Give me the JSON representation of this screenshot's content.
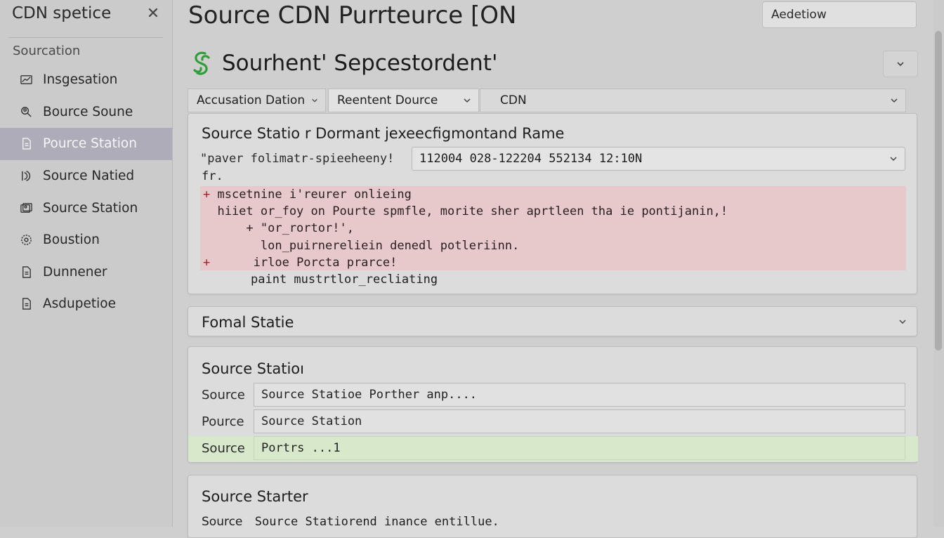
{
  "sidebar": {
    "title": "CDN spetice",
    "close_icon": "close-icon",
    "section": "Sourcation",
    "items": [
      {
        "label": "Insgesation",
        "icon": "chart-icon"
      },
      {
        "label": "Bource Soune",
        "icon": "search-user-icon"
      },
      {
        "label": "Pource Station",
        "icon": "document-icon",
        "active": true
      },
      {
        "label": "Source Natied",
        "icon": "sound-wave-icon"
      },
      {
        "label": "Source Station",
        "icon": "image-stack-icon"
      },
      {
        "label": "Boustion",
        "icon": "gear-icon"
      },
      {
        "label": "Dunnener",
        "icon": "document-icon"
      },
      {
        "label": "Asdupetioe",
        "icon": "document-icon"
      }
    ]
  },
  "header": {
    "title": "Source CDN Purrteurce [ON",
    "search_value": "Aedetiow"
  },
  "subheader": {
    "title": "Sourhent' Sepcestordent'",
    "logo_icon": "logo-swirl-icon",
    "logo_color": "#2f9e3a"
  },
  "filters": {
    "f1": "Accusation Dation",
    "f2": "Reentent Dource",
    "f3": "CDN"
  },
  "diff_panel": {
    "title": "Source Statio r Dormant  jexeecfigmontand Rame",
    "label": "\"paver folimatr-spieeheeny!",
    "select_value": "112004 028-122204 552134 12:10N",
    "fr": "fr.",
    "lines": [
      {
        "prefix": "+",
        "text": " mscetnine i'reurer onlieing"
      },
      {
        "prefix": "",
        "text": "  hiiet or_foy on Pourte spmfle, morite sher aprtleen tha ie pontijanin,!"
      },
      {
        "prefix": "",
        "text": "      + \"or_rortor!',"
      },
      {
        "prefix": "",
        "text": "        lon_puirnereliein denedl potleriinn."
      },
      {
        "prefix": "+",
        "text": "      irloe Porcta prarce!"
      }
    ],
    "normal_line": "paint mustrtlor_recliating"
  },
  "formal_panel": {
    "title": "Fomal Statie"
  },
  "form_panel": {
    "title": "Source Statioı",
    "rows": [
      {
        "label": "Source",
        "value": "Source Statioe Porther anp...."
      },
      {
        "label": "Pource",
        "value": "Source Station"
      },
      {
        "label": "Source",
        "value": "Portrs ...1",
        "highlight": true
      }
    ]
  },
  "starter_panel": {
    "title": "Source Starter",
    "line_label": "Source",
    "line_value": "Source Statiorend inance entillue."
  },
  "colors": {
    "active_sidebar": "#adacb8",
    "diff_removed_bg": "#e7c9cb",
    "highlight_row_bg": "#d8e8cb"
  }
}
